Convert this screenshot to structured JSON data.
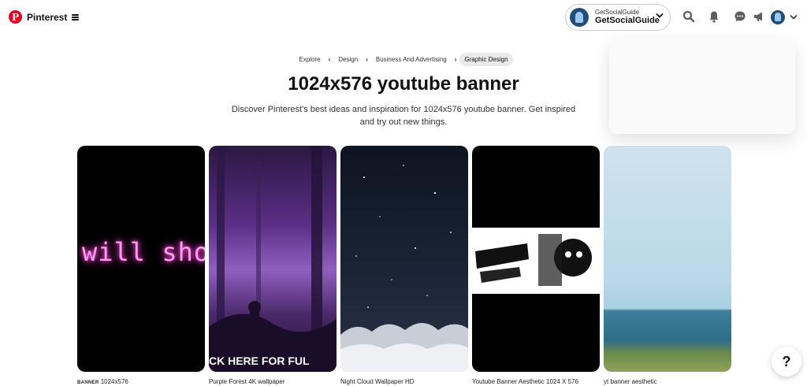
{
  "header": {
    "brand_name": "Pinterest",
    "account": {
      "small_label": "GetSocialGuide",
      "name": "GetSocialGuide"
    }
  },
  "breadcrumb": {
    "items": [
      "Explore",
      "Design",
      "Business And Advertising"
    ],
    "current": "Graphic Design"
  },
  "page": {
    "title": "1024x576 youtube banner",
    "description": "Discover Pinterest's best ideas and inspiration for 1024x576 youtube banner. Get inspired and try out new things."
  },
  "pins": [
    {
      "caption_prefix": "BANNER",
      "caption": "1024x576",
      "overlay_text": "will sho"
    },
    {
      "caption": "Purple Forest 4K wallpaper",
      "overlay_text": "CK HERE FOR FUL"
    },
    {
      "caption": "Night Cloud Wallpaper HD"
    },
    {
      "caption": "Youtube Banner Aesthetic 1024 X 576"
    },
    {
      "caption": "yt banner aesthetic"
    }
  ],
  "help": {
    "label": "?"
  },
  "colors": {
    "brand": "#e60023",
    "avatar": "#1f4e79"
  },
  "icons": [
    "pinterest-logo-icon",
    "menu-icon",
    "chevron-down-icon",
    "search-icon",
    "bell-icon",
    "messages-icon",
    "megaphone-icon"
  ]
}
